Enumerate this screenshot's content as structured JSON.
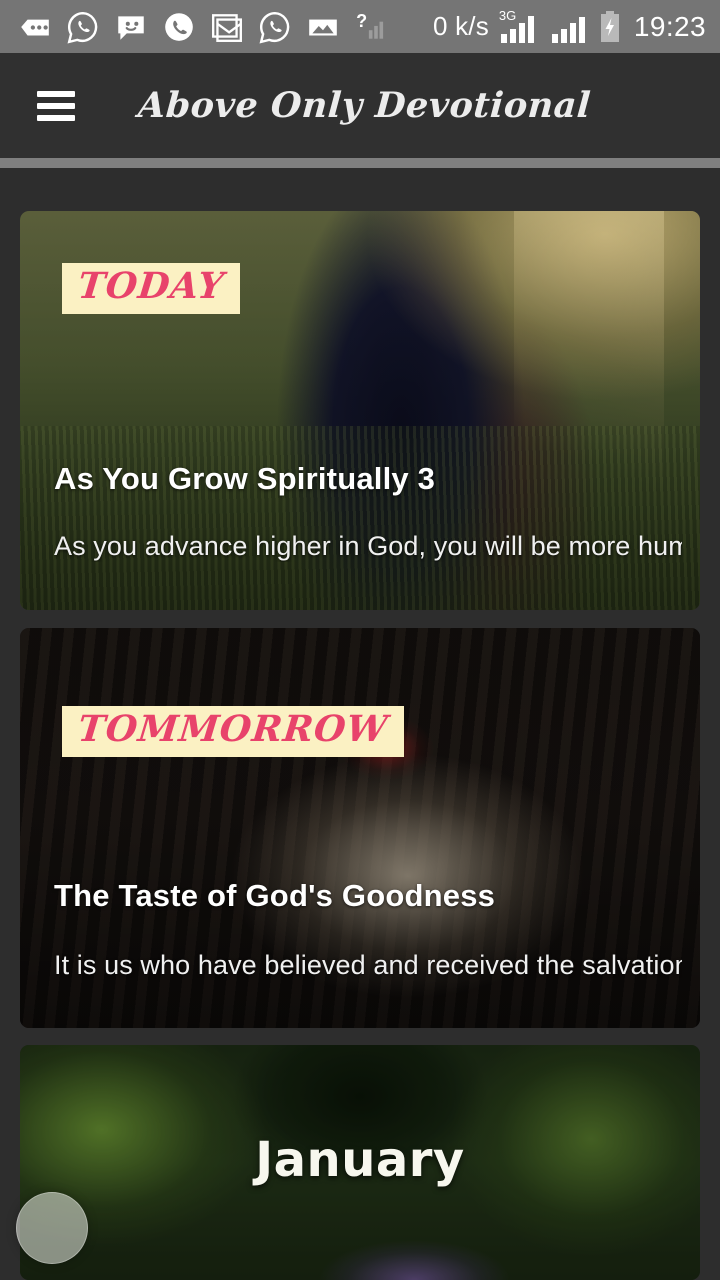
{
  "status_bar": {
    "icons": [
      {
        "name": "messages-dots-icon",
        "glyph": "speech-dots"
      },
      {
        "name": "whatsapp-icon",
        "glyph": "whatsapp"
      },
      {
        "name": "sms-smiley-icon",
        "glyph": "smiley-bubble"
      },
      {
        "name": "phone-call-icon",
        "glyph": "phone"
      },
      {
        "name": "gmail-icon",
        "glyph": "envelope-m"
      },
      {
        "name": "whatsapp-business-icon",
        "glyph": "whatsapp"
      },
      {
        "name": "screenshot-image-icon",
        "glyph": "photo"
      },
      {
        "name": "unknown-sim-signal-icon",
        "glyph": "question-signal"
      }
    ],
    "network_speed": "0 k/s",
    "network_type": "3G",
    "signal_label_1": "3G",
    "battery_state": "charging",
    "clock": "19:23"
  },
  "app_bar": {
    "menu_icon": "hamburger-menu-icon",
    "title": "Above Only Devotional"
  },
  "cards": [
    {
      "badge": "TODAY",
      "title": "As You Grow Spiritually 3",
      "excerpt": "As you advance higher in God, you will be more humbl...",
      "image_alt": "Two children reading a book in a sunlit grassy field"
    },
    {
      "badge": "TOMMORROW",
      "title": "The Taste of God's Goodness",
      "excerpt": "It is us who have believed and received the salvation f...",
      "image_alt": "Open highlighted Bible on a dark wooden surface"
    },
    {
      "month": "January",
      "image_alt": "Green foliage with purple flowers"
    }
  ],
  "floating_button": {
    "name": "assistive-touch-button"
  },
  "colors": {
    "status_bar_bg": "#757575",
    "app_bar_bg": "#303030",
    "page_bg": "#2d2d2d",
    "divider": "#7f7f7f",
    "badge_bg": "#fbf1c3",
    "badge_text": "#e8436b",
    "card_title_text": "#ffffff"
  }
}
